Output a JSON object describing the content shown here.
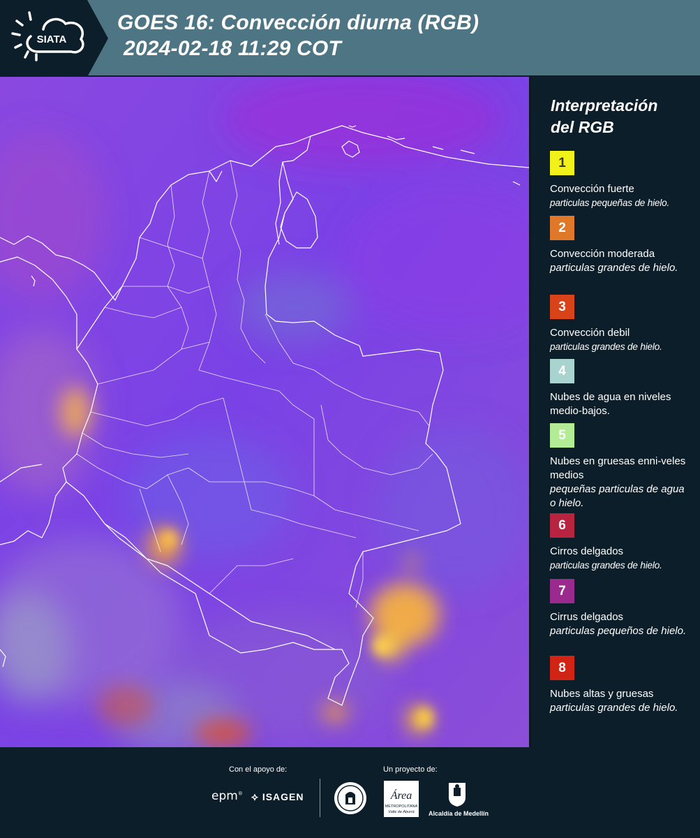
{
  "header": {
    "logo_text": "SIATA",
    "title_line1": "GOES 16: Convección diurna (RGB)",
    "title_line2": "2024-02-18 11:29 COT"
  },
  "map": {
    "background_color": "#7a3fe0",
    "border_color": "#ffffff"
  },
  "legend": {
    "title_line1": "Interpretación",
    "title_line2": "del RGB",
    "items": [
      {
        "number": "1",
        "color": "#f2f21a",
        "name": "Convección fuerte",
        "desc": "particulas pequeñas de hielo."
      },
      {
        "number": "2",
        "color": "#e0782a",
        "name": "Convección moderada",
        "desc": "particulas grandes de hielo."
      },
      {
        "number": "3",
        "color": "#d9431a",
        "name": "Convección debil",
        "desc": "particulas grandes de hielo."
      },
      {
        "number": "4",
        "color": "#a9d3cf",
        "name": "Nubes de agua en niveles medio-bajos.",
        "desc": ""
      },
      {
        "number": "5",
        "color": "#b2ec94",
        "name": "Nubes en gruesas enni-veles medios",
        "desc": "pequeñas particulas de agua o hielo."
      },
      {
        "number": "6",
        "color": "#b8233f",
        "name": "Cirros delgados",
        "desc": "particulas grandes de hielo."
      },
      {
        "number": "7",
        "color": "#9b2a8e",
        "name": "Cirrus delgados",
        "desc": "particulas pequeños de hielo."
      },
      {
        "number": "8",
        "color": "#d22414",
        "name": "Nubes altas y gruesas",
        "desc": "particulas grandes de hielo."
      }
    ]
  },
  "footer": {
    "support_label": "Con el apoyo de:",
    "project_label": "Un proyecto de:",
    "epm": "epm",
    "isagen": "ISAGEN",
    "area_text": "Área",
    "area_sub1": "METROPOLITANA",
    "area_sub2": "Valle de Aburrá",
    "alcaldia": "Alcaldía de Medellín"
  }
}
